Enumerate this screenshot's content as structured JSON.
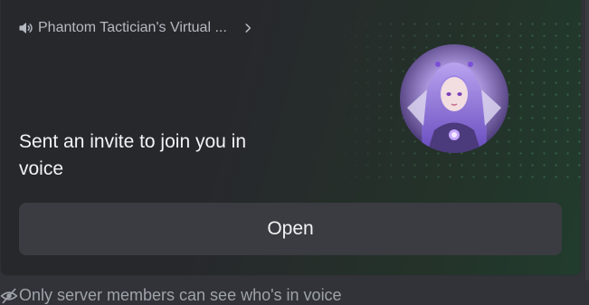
{
  "invite_card": {
    "channel_name": "Phantom Tactician's Virtual ...",
    "channel_icon": "speaker-icon",
    "chevron_icon": "chevron-right-icon",
    "message": "Sent an invite to join you in voice",
    "open_button_label": "Open",
    "avatar_alt": "avatar"
  },
  "footer": {
    "notice": "Only server members can see who's in voice",
    "notice_icon": "eye-off-icon"
  },
  "colors": {
    "card_background": "#27282c",
    "accent_green": "#213c2d",
    "button_background": "#3b3c41",
    "text_primary": "#f2f3f5",
    "text_muted": "#b5bac1"
  }
}
